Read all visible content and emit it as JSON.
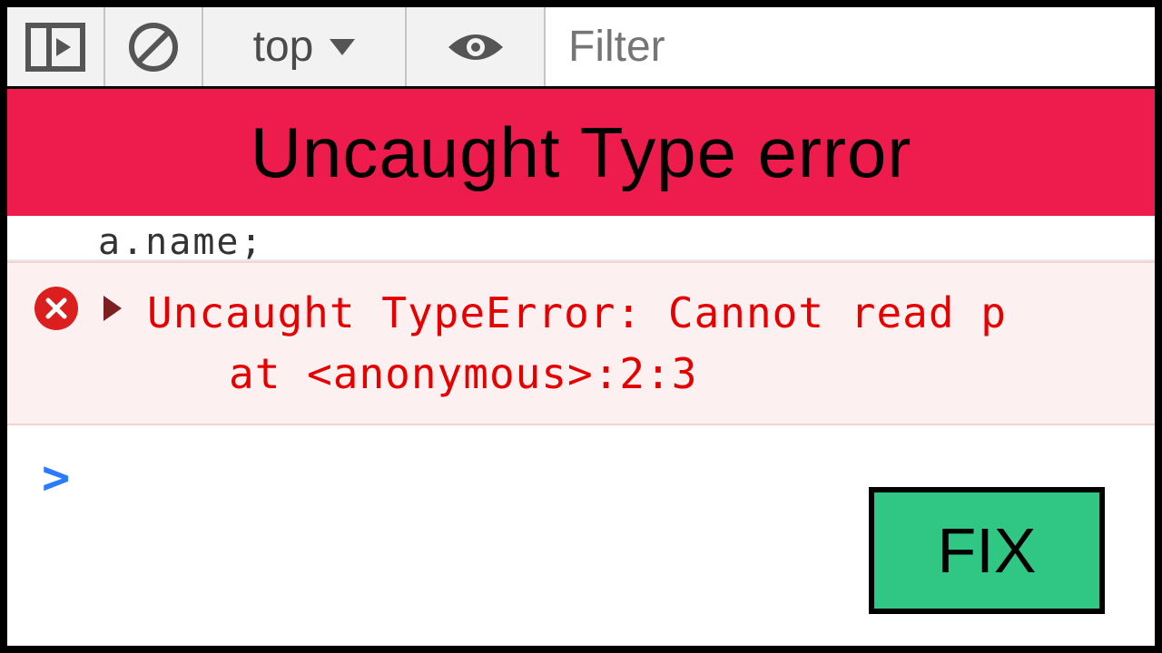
{
  "toolbar": {
    "context": "top",
    "filter_placeholder": "Filter"
  },
  "banner": {
    "title": "Uncaught Type error"
  },
  "console": {
    "remnant": "a.name;",
    "error_line_1": "Uncaught TypeError: Cannot read p",
    "error_line_2": "at <anonymous>:2:3",
    "prompt": ">"
  },
  "fix_button": {
    "label": "FIX"
  }
}
